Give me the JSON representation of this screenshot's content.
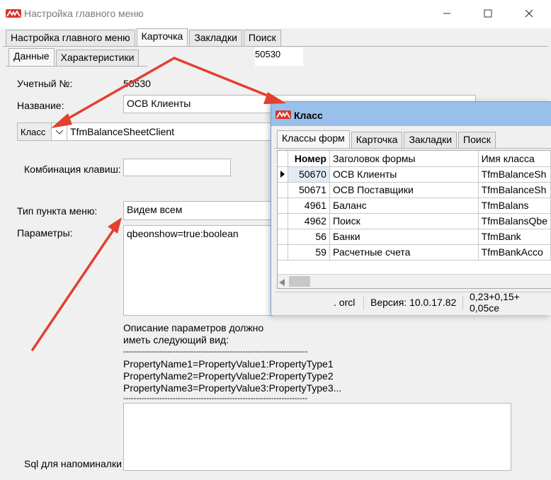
{
  "window": {
    "title": "Настройка главного меню"
  },
  "tabs": [
    "Настройка главного меню",
    "Карточка",
    "Закладки",
    "Поиск"
  ],
  "tab_badge": "50530",
  "subtabs": [
    "Данные",
    "Характеристики"
  ],
  "form": {
    "account_label": "Учетный №:",
    "account_value": "50530",
    "name_label": "Название:",
    "name_value": "ОСВ Клиенты",
    "class_label": "Класс",
    "class_value": "TfmBalanceSheetClient",
    "hotkey_label": "Комбинация клавиш:",
    "hotkey_value": "",
    "menutype_label": "Тип пункта меню:",
    "menutype_value": "Видем всем",
    "params_label": "Параметры:",
    "params_value": "qbeonshow=true:boolean",
    "desc_lines": [
      "Описание параметров должно",
      "иметь следующий вид:",
      "-----------------------------------------------------------------------",
      "PropertyName1=PropertyValue1:PropertyType1",
      "PropertyName2=PropertyValue2:PropertyType2",
      "PropertyName3=PropertyValue3:PropertyType3...",
      "-----------------------------------------------------------------------"
    ],
    "sql_label": "Sql для напоминалки"
  },
  "dialog": {
    "title": "Класс",
    "tabs": [
      "Классы форм",
      "Карточка",
      "Закладки",
      "Поиск"
    ],
    "columns": [
      "Номер",
      "Заголовок формы",
      "Имя класса"
    ],
    "rows": [
      {
        "num": "50670",
        "title": "ОСВ Клиенты",
        "cls": "TfmBalanceSh"
      },
      {
        "num": "50671",
        "title": "ОСВ Поставщики",
        "cls": "TfmBalanceSh"
      },
      {
        "num": "4961",
        "title": "Баланс",
        "cls": "TfmBalans"
      },
      {
        "num": "4962",
        "title": "Поиск",
        "cls": "TfmBalansQbe"
      },
      {
        "num": "56",
        "title": "Банки",
        "cls": "TfmBank"
      },
      {
        "num": "59",
        "title": "Расчетные счета",
        "cls": "TfmBankAcco"
      }
    ],
    "status": {
      "db": ". orcl",
      "version": "Версия: 10.0.17.82",
      "timing": "0,23+0,15+ 0,05се"
    }
  },
  "colors": {
    "accent": "#e3402f",
    "dialog_title": "#98c0ea",
    "logo": "#d9342b"
  },
  "icons": {
    "logo": "app-logo-icon",
    "minimize": "minimize-icon",
    "maximize": "maximize-icon",
    "close": "close-icon",
    "dropdown": "chevron-down-icon",
    "row_pointer": "row-pointer-icon"
  }
}
